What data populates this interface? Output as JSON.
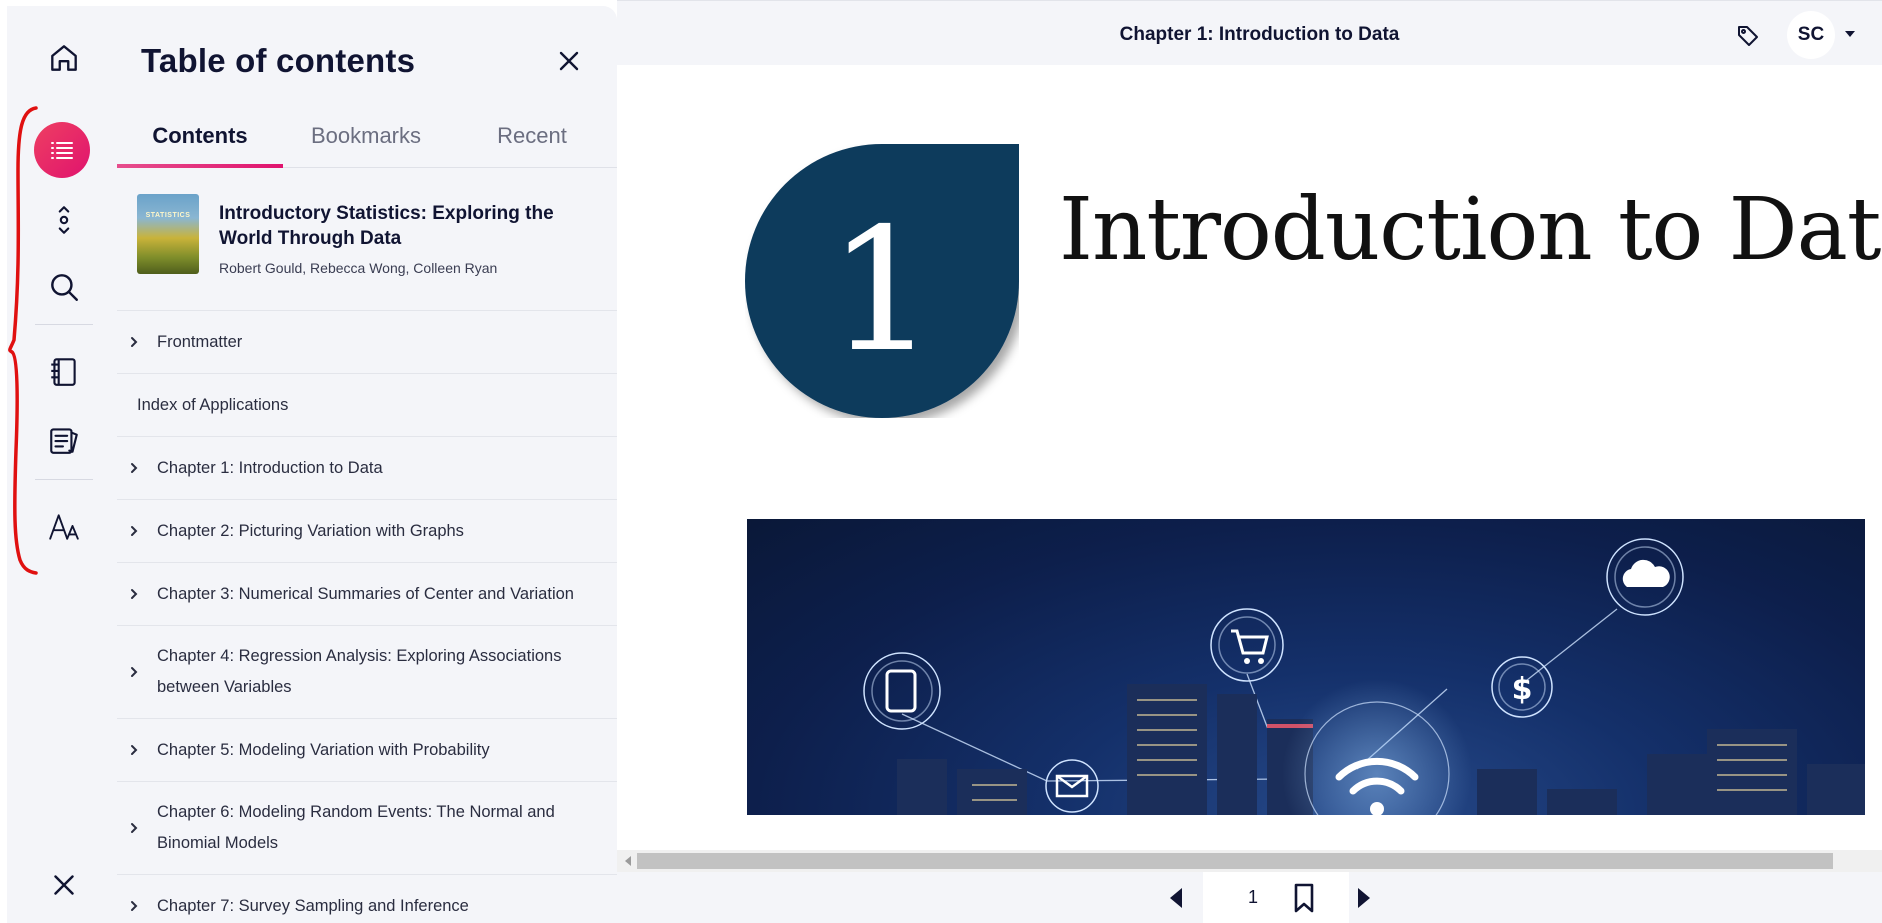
{
  "header": {
    "title": "Chapter 1: Introduction to Data",
    "user_initials": "SC"
  },
  "rail": {
    "icons": [
      "home-icon",
      "list-icon",
      "chevron-up-down-icon",
      "search-icon",
      "notebook-icon",
      "flashcards-icon",
      "text-size-icon",
      "close-icon"
    ],
    "active_color": "#e0136e"
  },
  "toc": {
    "title": "Table of contents",
    "tabs": [
      "Contents",
      "Bookmarks",
      "Recent"
    ],
    "book": {
      "cover_text": "STATISTICS",
      "title": "Introductory Statistics: Exploring the World Through Data",
      "authors": "Robert Gould, Rebecca Wong, Colleen Ryan"
    },
    "items": [
      "Frontmatter",
      "Index of Applications",
      "Chapter 1: Introduction to Data",
      "Chapter 2: Picturing Variation with Graphs",
      "Chapter 3: Numerical Summaries of Center and Variation",
      "Chapter 4: Regression Analysis: Exploring Associations between Variables",
      "Chapter 5: Modeling Variation with Probability",
      "Chapter 6: Modeling Random Events: The Normal and Binomial Models",
      "Chapter 7: Survey Sampling and Inference"
    ]
  },
  "content": {
    "chapter_number": "1",
    "chapter_title": "Introduction to Data",
    "badge_color": "#0d3a5c"
  },
  "pager": {
    "page_number": "1"
  },
  "annotation_color": "#e01010"
}
